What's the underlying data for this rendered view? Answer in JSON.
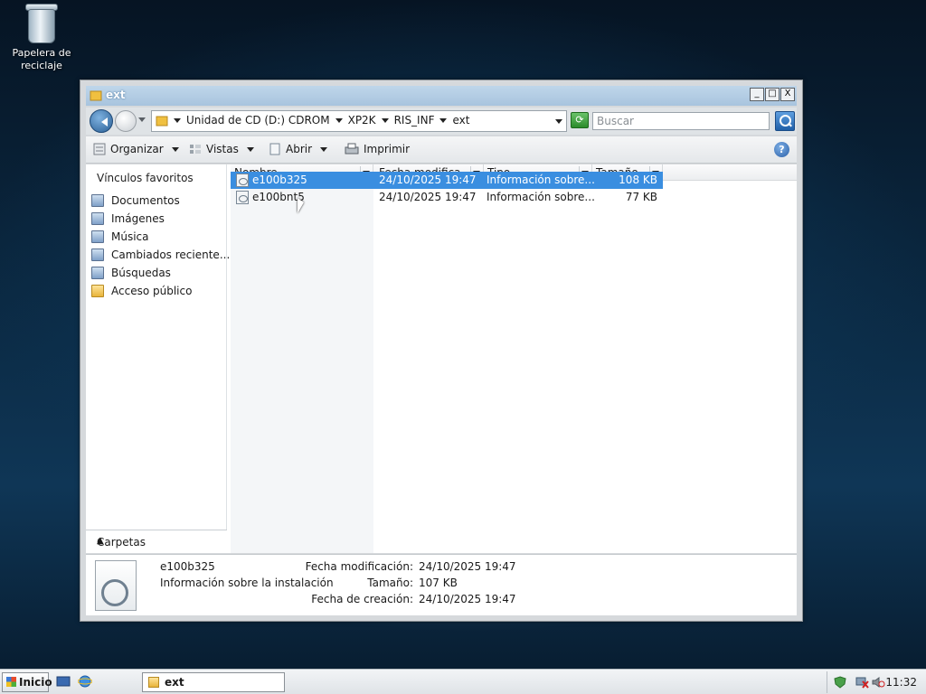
{
  "desktop": {
    "recycle_bin_label": "Papelera de reciclaje"
  },
  "window": {
    "title": "ext",
    "controls": [
      "_",
      "□",
      "X"
    ]
  },
  "address_bar": {
    "crumbs": [
      "Unidad de CD (D:) CDROM",
      "XP2K",
      "RIS_INF",
      "ext"
    ],
    "search_placeholder": "Buscar"
  },
  "toolbar": {
    "organize": "Organizar",
    "views": "Vistas",
    "open": "Abrir",
    "print": "Imprimir",
    "help": "?"
  },
  "nav_pane": {
    "heading": "Vínculos favoritos",
    "items": [
      {
        "label": "Documentos"
      },
      {
        "label": "Imágenes"
      },
      {
        "label": "Música"
      },
      {
        "label": "Cambiados reciente..."
      },
      {
        "label": "Búsquedas"
      },
      {
        "label": "Acceso público"
      }
    ],
    "folders_label": "Carpetas"
  },
  "file_list": {
    "columns": [
      "Nombre",
      "Fecha modifica...",
      "Tipo",
      "Tamaño"
    ],
    "rows": [
      {
        "name": "e100b325",
        "date": "24/10/2025 19:47",
        "type": "Información sobre...",
        "size": "108 KB",
        "selected": true
      },
      {
        "name": "e100bnt5",
        "date": "24/10/2025 19:47",
        "type": "Información sobre...",
        "size": "77 KB",
        "selected": false
      }
    ]
  },
  "details": {
    "name": "e100b325",
    "type": "Información sobre la instalación",
    "modified_label": "Fecha modificación:",
    "modified_value": "24/10/2025 19:47",
    "size_label": "Tamaño:",
    "size_value": "107 KB",
    "created_label": "Fecha de creación:",
    "created_value": "24/10/2025 19:47"
  },
  "taskbar": {
    "start_label": "Inicio",
    "window_button": "ext",
    "clock": "11:32"
  }
}
